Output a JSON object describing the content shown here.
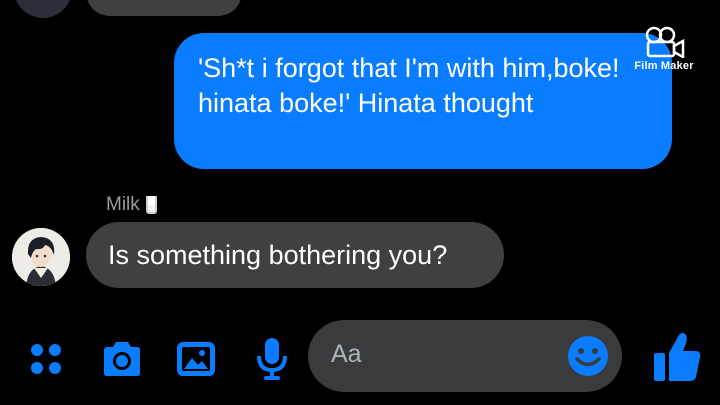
{
  "conversation": {
    "outgoing_message": "'Sh*t i forgot that I'm with him,boke! hinata boke!' Hinata thought",
    "incoming_sender": "Milk",
    "incoming_message": "Is something bothering you?"
  },
  "watermark": {
    "text": "Film Maker",
    "icon": "film-camera-icon"
  },
  "composer": {
    "placeholder": "Aa",
    "icons": [
      "apps-grid-icon",
      "camera-icon",
      "image-icon",
      "microphone-icon",
      "emoji-icon",
      "thumbs-up-icon"
    ]
  },
  "colors": {
    "accent": "#0a7cff",
    "incoming_bubble": "#3e4042",
    "input_bg": "#3a3b3c",
    "background": "#000000"
  }
}
